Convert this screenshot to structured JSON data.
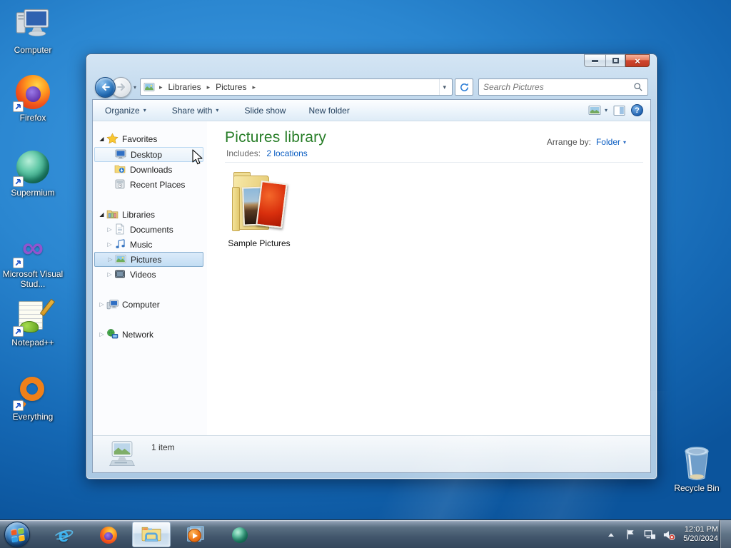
{
  "desktop": {
    "icons": [
      {
        "label": "Computer"
      },
      {
        "label": "Firefox"
      },
      {
        "label": "Supermium"
      },
      {
        "label": "Microsoft Visual Stud..."
      },
      {
        "label": "Notepad++"
      },
      {
        "label": "Everything"
      }
    ],
    "recycle_bin": {
      "label": "Recycle Bin"
    }
  },
  "explorer": {
    "breadcrumb": {
      "items": [
        "Libraries",
        "Pictures"
      ]
    },
    "search": {
      "placeholder": "Search Pictures"
    },
    "toolbar": {
      "organize": "Organize",
      "share_with": "Share with",
      "slide_show": "Slide show",
      "new_folder": "New folder"
    },
    "sidebar": {
      "favorites": {
        "label": "Favorites",
        "items": [
          {
            "label": "Desktop"
          },
          {
            "label": "Downloads"
          },
          {
            "label": "Recent Places"
          }
        ]
      },
      "libraries": {
        "label": "Libraries",
        "items": [
          {
            "label": "Documents"
          },
          {
            "label": "Music"
          },
          {
            "label": "Pictures"
          },
          {
            "label": "Videos"
          }
        ]
      },
      "computer": {
        "label": "Computer"
      },
      "network": {
        "label": "Network"
      }
    },
    "content": {
      "title": "Pictures library",
      "includes_label": "Includes:",
      "includes_link": "2 locations",
      "arrange_label": "Arrange by:",
      "arrange_value": "Folder",
      "items": [
        {
          "label": "Sample Pictures"
        }
      ]
    },
    "statusbar": {
      "count": "1 item"
    }
  },
  "taskbar": {
    "clock": {
      "time": "12:01 PM",
      "date": "5/20/2024"
    }
  },
  "colors": {
    "library_title_green": "#277d27",
    "link_blue": "#0a5dc2",
    "selection_blue": "#c2ddf3",
    "close_button_red": "#cf4730",
    "desktop_blue": "#2a86d0"
  }
}
